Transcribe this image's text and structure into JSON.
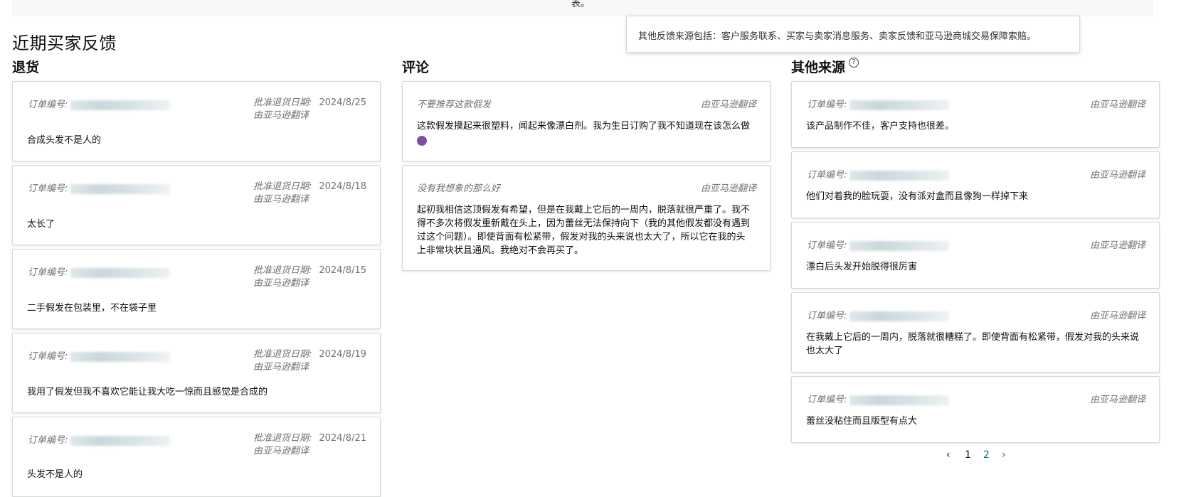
{
  "top_strip_text": "表。",
  "section_title": "近期买家反馈",
  "tooltip_text": "其他反馈来源包括：客户服务联系、买家与卖家消息服务、卖家反馈和亚马逊商城交易保障索赔。",
  "columns": {
    "returns": "退货",
    "reviews": "评论",
    "other": "其他来源"
  },
  "labels": {
    "order_no": "订单编号:",
    "approved_date": "批准退货日期:",
    "translated": "由亚马逊翻译"
  },
  "returns": [
    {
      "date": "2024/8/25",
      "text": "合成头发不是人的"
    },
    {
      "date": "2024/8/18",
      "text": "太长了"
    },
    {
      "date": "2024/8/15",
      "text": "二手假发在包装里，不在袋子里"
    },
    {
      "date": "2024/8/19",
      "text": "我用了假发但我不喜欢它能让我大吃一惊而且感觉是合成的"
    },
    {
      "date": "2024/8/21",
      "text": "头发不是人的"
    }
  ],
  "reviews": [
    {
      "title": "不要推荐这款假发",
      "lines": [
        "这款假发摸起来很塑料，闻起来像漂白剂。我为生日订购了我不知道现在该怎么做"
      ],
      "has_emoji": true
    },
    {
      "title": "没有我想象的那么好",
      "lines": [
        "起初我相信这顶假发有希望，但是在我戴上它后的一周内，脱落就很严重了。我不",
        "得不多次将假发重新戴在头上，因为蕾丝无法保持向下（我的其他假发都没有遇到",
        "过这个问题）。即使背面有松紧带，假发对我的头来说也太大了，所以它在我的头",
        "上非常块状且通风。我绝对不会再买了。"
      ],
      "has_emoji": false
    }
  ],
  "other": [
    {
      "lines": [
        "该产品制作不佳，客户支持也很差。"
      ]
    },
    {
      "lines": [
        "他们对着我的脸玩耍，没有派对盒而且像狗一样掉下来"
      ]
    },
    {
      "lines": [
        "漂白后头发开始脱得很厉害"
      ]
    },
    {
      "lines": [
        "在我戴上它后的一周内，脱落就很糟糕了。即使背面有松紧带，假发对我的头来说",
        "也太大了"
      ]
    },
    {
      "lines": [
        "蕾丝没粘住而且版型有点大"
      ]
    }
  ],
  "pagination": {
    "prev": "‹",
    "page1": "1",
    "page2": "2",
    "next": "›"
  }
}
